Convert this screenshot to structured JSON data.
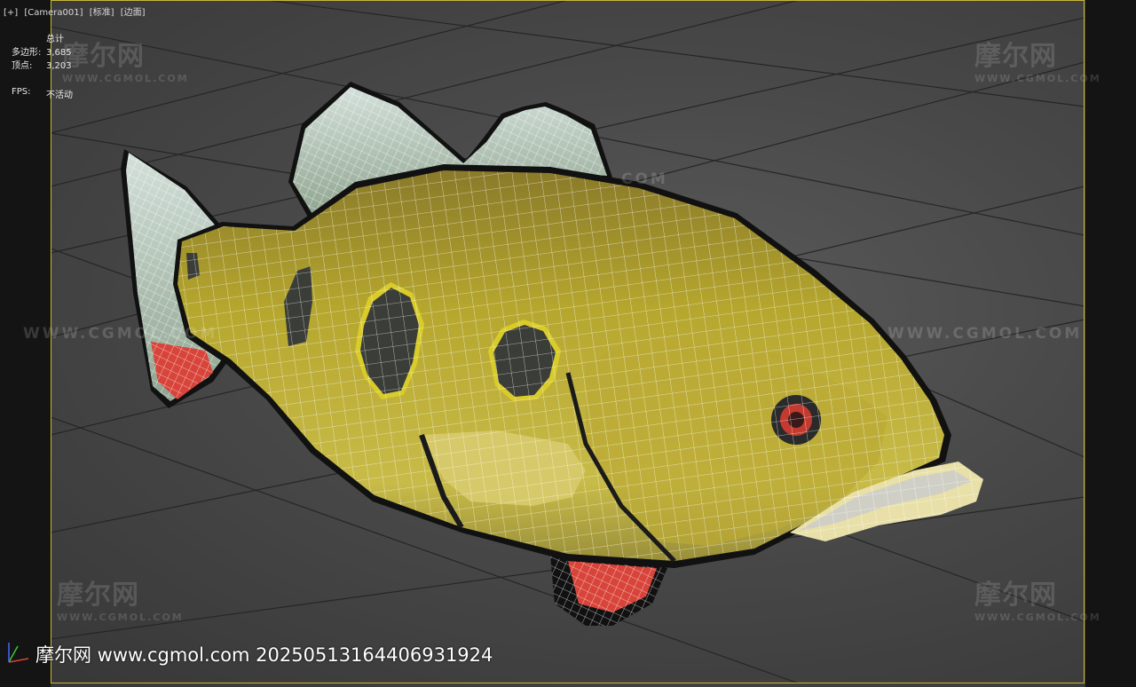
{
  "viewport_label": {
    "plus": "[+]",
    "camera": "[Camera001]",
    "shading": "[标准]",
    "edges": "[边面]"
  },
  "stats": {
    "title": "总计",
    "polys_label": "多边形:",
    "polys_value": "3,685",
    "verts_label": "顶点:",
    "verts_value": "3,203",
    "fps_label": "FPS:",
    "fps_value": "不活动"
  },
  "watermarks": {
    "logo_text": "摩尔网",
    "logo_sub": "WWW.CGMOL.COM",
    "line_text": "WWW.CGMOL.COM",
    "partial_text": "COM"
  },
  "footer": {
    "text": "摩尔网 www.cgmol.com 20250513164406931924"
  },
  "colors": {
    "frame": "#c9b73a",
    "grid": "#262626",
    "fish_body": "#b5a62e",
    "fin": "#b8c9c2",
    "red_fin": "#d8443a"
  }
}
